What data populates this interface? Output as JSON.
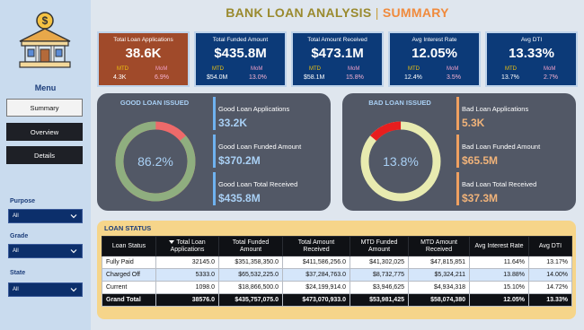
{
  "title": {
    "part1": "BANK LOAN ANALYSIS",
    "sep": "|",
    "part2": "SUMMARY"
  },
  "sidebar": {
    "logo_icon": "bank-dollar-icon",
    "menu_label": "Menu",
    "buttons": [
      {
        "label": "Summary",
        "active": true
      },
      {
        "label": "Overview",
        "active": false
      },
      {
        "label": "Details",
        "active": false
      }
    ],
    "filters": [
      {
        "label": "Purpose",
        "value": "All"
      },
      {
        "label": "Grade",
        "value": "All"
      },
      {
        "label": "State",
        "value": "All"
      }
    ]
  },
  "kpis": [
    {
      "title": "Total Loan Applications",
      "value": "38.6K",
      "mtd_label": "MTD",
      "mtd": "4.3K",
      "mom_label": "MoM",
      "mom": "6.9%"
    },
    {
      "title": "Total Funded Amount",
      "value": "$435.8M",
      "mtd_label": "MTD",
      "mtd": "$54.0M",
      "mom_label": "MoM",
      "mom": "13.0%"
    },
    {
      "title": "Total Amount Received",
      "value": "$473.1M",
      "mtd_label": "MTD",
      "mtd": "$58.1M",
      "mom_label": "MoM",
      "mom": "15.8%"
    },
    {
      "title": "Avg Interest Rate",
      "value": "12.05%",
      "mtd_label": "MTD",
      "mtd": "12.4%",
      "mom_label": "MoM",
      "mom": "3.5%"
    },
    {
      "title": "Avg DTI",
      "value": "13.33%",
      "mtd_label": "MTD",
      "mtd": "13.7%",
      "mom_label": "MoM",
      "mom": "2.7%"
    }
  ],
  "good_loan": {
    "title": "GOOD LOAN ISSUED",
    "percent_label": "86.2%",
    "percent": 0.862,
    "ring_color": "#8fae7f",
    "rest_color": "#ee6a6a",
    "metrics": [
      {
        "label": "Good Loan Applications",
        "value": "33.2K"
      },
      {
        "label": "Good Loan Funded Amount",
        "value": "$370.2M"
      },
      {
        "label": "Good Loan Total Received",
        "value": "$435.8M"
      }
    ]
  },
  "bad_loan": {
    "title": "BAD LOAN ISSUED",
    "percent_label": "13.8%",
    "percent": 0.138,
    "ring_color": "#e8ebb0",
    "rest_color": "#e81e1e",
    "metrics": [
      {
        "label": "Bad Loan Applications",
        "value": "5.3K"
      },
      {
        "label": "Bad Loan Funded Amount",
        "value": "$65.5M"
      },
      {
        "label": "Bad Loan Total Received",
        "value": "$37.3M"
      }
    ]
  },
  "loan_status": {
    "title": "LOAN STATUS",
    "headers": [
      "Loan Status",
      "Total Loan Applications",
      "Total Funded Amount",
      "Total Amount Received",
      "MTD Funded Amount",
      "MTD Amount Received",
      "Avg Interest Rate",
      "Avg DTI"
    ],
    "rows": [
      [
        "Fully Paid",
        "32145.0",
        "$351,358,350.0",
        "$411,586,256.0",
        "$41,302,025",
        "$47,815,851",
        "11.64%",
        "13.17%"
      ],
      [
        "Charged Off",
        "5333.0",
        "$65,532,225.0",
        "$37,284,763.0",
        "$8,732,775",
        "$5,324,211",
        "13.88%",
        "14.00%"
      ],
      [
        "Current",
        "1098.0",
        "$18,866,500.0",
        "$24,199,914.0",
        "$3,946,625",
        "$4,934,318",
        "15.10%",
        "14.72%"
      ]
    ],
    "total": [
      "Grand Total",
      "38576.0",
      "$435,757,075.0",
      "$473,070,933.0",
      "$53,981,425",
      "$58,074,380",
      "12.05%",
      "13.33%"
    ]
  },
  "colors": {
    "accent_blue": "#0c3a78",
    "first_card": "#a04a2a",
    "good_value": "#a9d0f5",
    "bad_value": "#f0b37a",
    "good_bar": "#6fb2f0",
    "bad_bar": "#f0a060"
  }
}
